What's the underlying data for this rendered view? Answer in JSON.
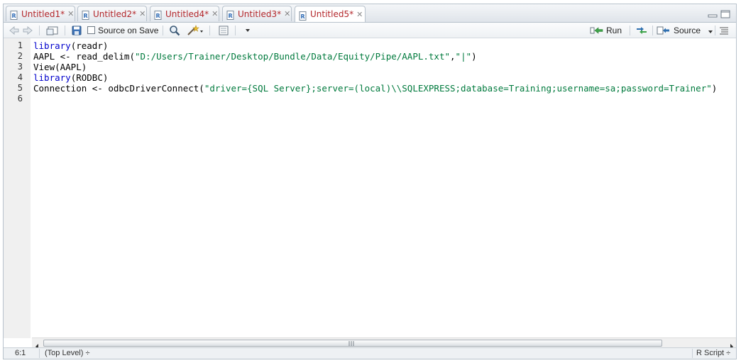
{
  "tabs": [
    {
      "label": "Untitled1*",
      "active": false
    },
    {
      "label": "Untitled2*",
      "active": false
    },
    {
      "label": "Untitled4*",
      "active": false
    },
    {
      "label": "Untitled3*",
      "active": false
    },
    {
      "label": "Untitled5*",
      "active": true
    }
  ],
  "toolbar": {
    "source_on_save_label": "Source on Save",
    "run_label": "Run",
    "source_label": "Source"
  },
  "editor": {
    "line_numbers": [
      "1",
      "2",
      "3",
      "4",
      "5",
      "6"
    ],
    "lines": [
      [
        {
          "t": "library",
          "c": "kw"
        },
        {
          "t": "(readr)",
          "c": ""
        }
      ],
      [
        {
          "t": "AAPL <- read_delim(",
          "c": ""
        },
        {
          "t": "\"D:/Users/Trainer/Desktop/Bundle/Data/Equity/Pipe/AAPL.txt\"",
          "c": "str"
        },
        {
          "t": ",",
          "c": ""
        },
        {
          "t": "\"|\"",
          "c": "str"
        },
        {
          "t": ")",
          "c": ""
        }
      ],
      [
        {
          "t": "View(AAPL)",
          "c": ""
        }
      ],
      [
        {
          "t": "library",
          "c": "kw"
        },
        {
          "t": "(RODBC)",
          "c": ""
        }
      ],
      [
        {
          "t": "Connection <- odbcDriverConnect(",
          "c": ""
        },
        {
          "t": "\"driver={SQL Server};server=(local)\\\\SQLEXPRESS;database=Training;username=sa;password=Trainer\"",
          "c": "str"
        },
        {
          "t": ")",
          "c": ""
        }
      ],
      []
    ]
  },
  "status": {
    "position": "6:1",
    "scope": "(Top Level) ÷",
    "file_type": "R Script ÷"
  },
  "colors": {
    "tab_label": "#b3262a",
    "keyword": "#0000cc",
    "string": "#007a3d"
  }
}
